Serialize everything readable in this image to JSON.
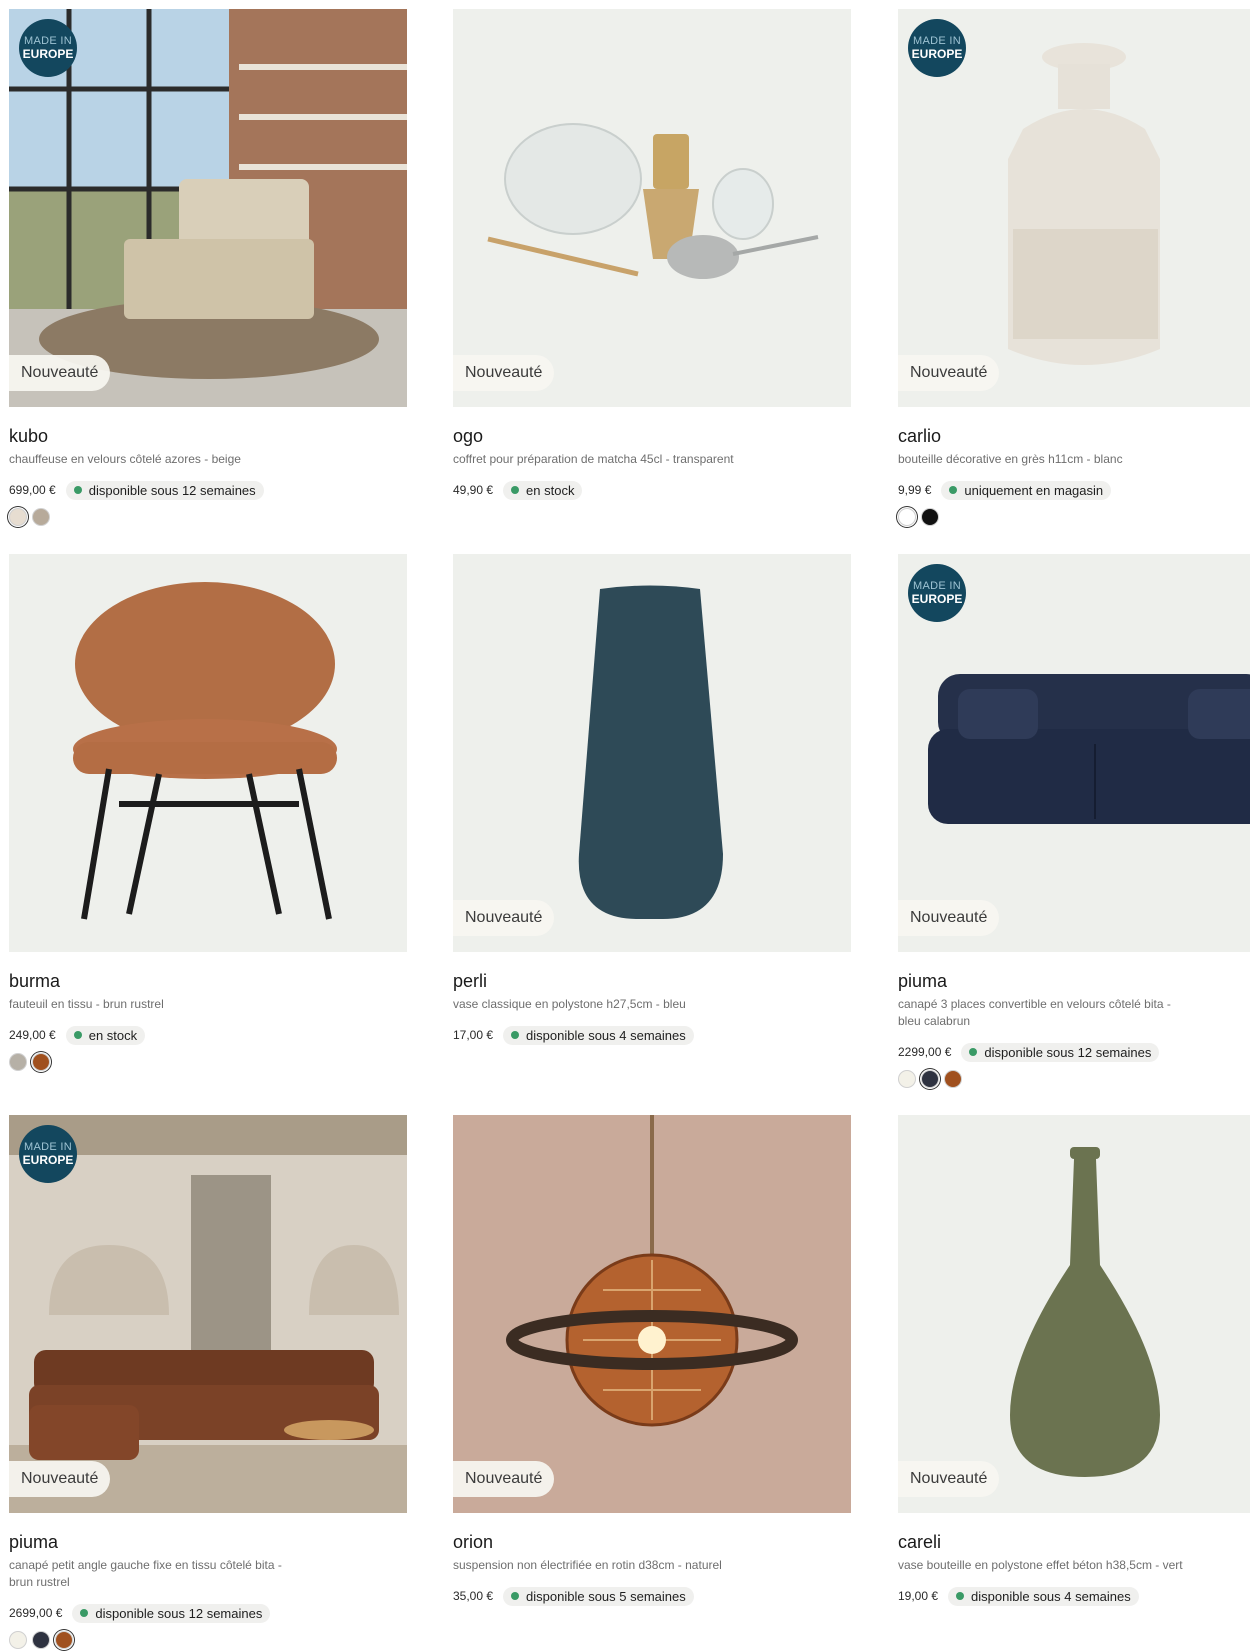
{
  "badges": {
    "made_in_line1": "MADE IN",
    "made_in_line2": "EUROPE",
    "new": "Nouveauté"
  },
  "colors": {
    "stock_dot": "#3a9a66",
    "badge_bg": "#13475e",
    "image_bg": "#eef0ec"
  },
  "products": [
    {
      "name": "kubo",
      "desc": "chauffeuse en velours côtelé azores - beige",
      "price": "699,00 €",
      "availability": "disponible sous 12 semaines",
      "made_in_europe": true,
      "is_new": true,
      "swatches": [
        "#e7ddd1",
        "#b7aa9a"
      ],
      "image": "lounge-chair-room-photo"
    },
    {
      "name": "ogo",
      "desc": "coffret pour préparation de matcha 45cl - transparent",
      "price": "49,90 €",
      "availability": "en stock",
      "made_in_europe": false,
      "is_new": true,
      "swatches": [],
      "image": "matcha-set"
    },
    {
      "name": "carlio",
      "desc": "bouteille décorative en grès h11cm - blanc",
      "price": "9,99 €",
      "availability": "uniquement en magasin",
      "made_in_europe": true,
      "is_new": true,
      "swatches": [
        "#ffffff",
        "#111111"
      ],
      "image": "ceramic-bottle"
    },
    {
      "name": "burma",
      "desc": "fauteuil en tissu - brun rustrel",
      "price": "249,00 €",
      "availability": "en stock",
      "made_in_europe": false,
      "is_new": false,
      "swatches": [
        "#b6b0a6",
        "#a0501e"
      ],
      "image": "armchair"
    },
    {
      "name": "perli",
      "desc": "vase classique en polystone h27,5cm - bleu",
      "price": "17,00 €",
      "availability": "disponible sous 4 semaines",
      "made_in_europe": false,
      "is_new": true,
      "swatches": [],
      "image": "blue-vase"
    },
    {
      "name": "piuma",
      "desc": "canapé 3 places convertible en velours côtelé bita - bleu calabrun",
      "price": "2299,00 €",
      "availability": "disponible sous 12 semaines",
      "made_in_europe": true,
      "is_new": true,
      "swatches": [
        "#f3f1e8",
        "#2e3240",
        "#a0501e"
      ],
      "image": "navy-sofa"
    },
    {
      "name": "piuma",
      "desc": "canapé petit angle gauche fixe en tissu côtelé bita - brun rustrel",
      "price": "2699,00 €",
      "availability": "disponible sous 12 semaines",
      "made_in_europe": true,
      "is_new": true,
      "swatches": [
        "#f3f1e8",
        "#2e3240",
        "#a0501e"
      ],
      "image": "corner-sofa-room-photo"
    },
    {
      "name": "orion",
      "desc": "suspension non électrifiée en rotin d38cm - naturel",
      "price": "35,00 €",
      "availability": "disponible sous 5 semaines",
      "made_in_europe": false,
      "is_new": true,
      "swatches": [],
      "image": "rattan-pendant"
    },
    {
      "name": "careli",
      "desc": "vase bouteille en polystone effet béton h38,5cm - vert",
      "price": "19,00 €",
      "availability": "disponible sous 4 semaines",
      "made_in_europe": false,
      "is_new": true,
      "swatches": [],
      "image": "green-vase"
    }
  ]
}
